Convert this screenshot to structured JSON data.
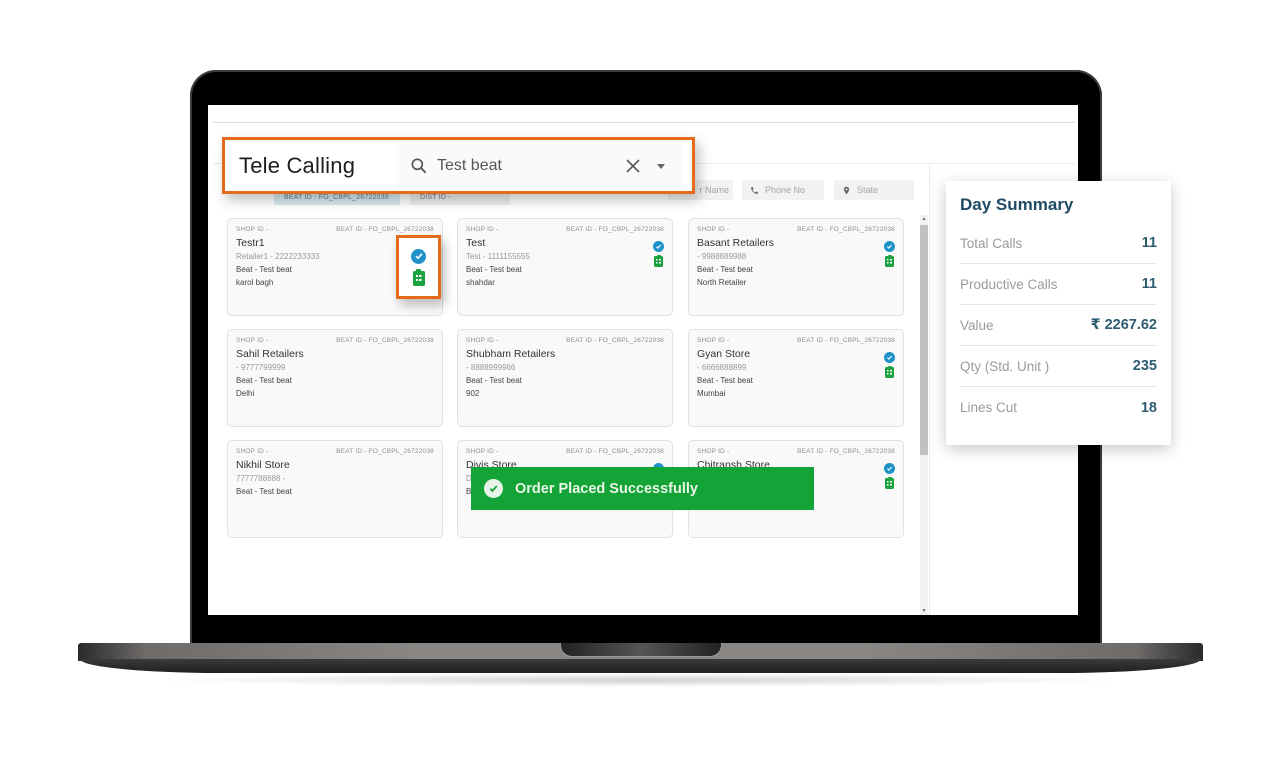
{
  "app": {
    "title": "Tele Calling",
    "search": {
      "value": "Test beat"
    }
  },
  "chips": {
    "beat_id": "BEAT ID - FO_CBPL_26722038",
    "dist_id": "DIST ID -"
  },
  "filters": {
    "retailer_name": "r Name",
    "phone_no": "Phone No",
    "state": "State"
  },
  "cards": [
    {
      "shop_id": "SHOP ID -",
      "beat_id": "BEAT ID - FO_CBPL_26722038",
      "name": "Testr1",
      "sub": "Retailer1 - 2222233333",
      "beat": "Beat - Test beat",
      "area": "karol bagh",
      "verified": true,
      "order": true
    },
    {
      "shop_id": "SHOP ID -",
      "beat_id": "BEAT ID - FO_CBPL_26722038",
      "name": "Test",
      "sub": "Test - 1111155555",
      "beat": "Beat - Test beat",
      "area": "shahdar",
      "verified": true,
      "order": true
    },
    {
      "shop_id": "SHOP ID -",
      "beat_id": "BEAT ID - FO_CBPL_26722038",
      "name": "Basant Retailers",
      "sub": "- 9988889988",
      "beat": "Beat - Test beat",
      "area": "North Retailer",
      "verified": true,
      "order": true
    },
    {
      "shop_id": "SHOP ID -",
      "beat_id": "BEAT ID - FO_CBPL_26722038",
      "name": "Sahil Retailers",
      "sub": "- 9777799999",
      "beat": "Beat - Test beat",
      "area": "Delhi",
      "verified": false,
      "order": false
    },
    {
      "shop_id": "SHOP ID -",
      "beat_id": "BEAT ID - FO_CBPL_26722038",
      "name": "Shubham Retailers",
      "sub": "- 8888999966",
      "beat": "Beat - Test beat",
      "area": "902",
      "verified": false,
      "order": false
    },
    {
      "shop_id": "SHOP ID -",
      "beat_id": "BEAT ID - FO_CBPL_26722038",
      "name": "Gyan Store",
      "sub": "- 6666888899",
      "beat": "Beat - Test beat",
      "area": "Mumbai",
      "verified": true,
      "order": true
    },
    {
      "shop_id": "SHOP ID -",
      "beat_id": "BEAT ID - FO_CBPL_26722038",
      "name": "Nikhil Store",
      "sub": "7777788888 -",
      "beat": "Beat - Test beat",
      "area": "",
      "verified": false,
      "order": false
    },
    {
      "shop_id": "SHOP ID -",
      "beat_id": "BEAT ID - FO_CBPL_26722038",
      "name": "Divis Store",
      "sub": "D",
      "beat": "B",
      "area": "",
      "verified": true,
      "order": false
    },
    {
      "shop_id": "SHOP ID -",
      "beat_id": "BEAT ID - FO_CBPL_26722038",
      "name": "Chitransh Store",
      "sub": "",
      "beat": "",
      "area": "",
      "verified": true,
      "order": true
    }
  ],
  "summary": {
    "title": "Day Summary",
    "rows": [
      {
        "label": "Total Calls",
        "value": "11"
      },
      {
        "label": "Productive Calls",
        "value": "11"
      },
      {
        "label": "Value",
        "value": "₹  2267.62"
      },
      {
        "label": "Qty (Std. Unit )",
        "value": "235"
      },
      {
        "label": "Lines Cut",
        "value": "18"
      }
    ]
  },
  "toast": {
    "message": "Order Placed Successfully"
  },
  "colors": {
    "highlight": "#e46a1c",
    "success": "#14a336",
    "check": "#1f93c8",
    "summary_title": "#1f4a63"
  }
}
